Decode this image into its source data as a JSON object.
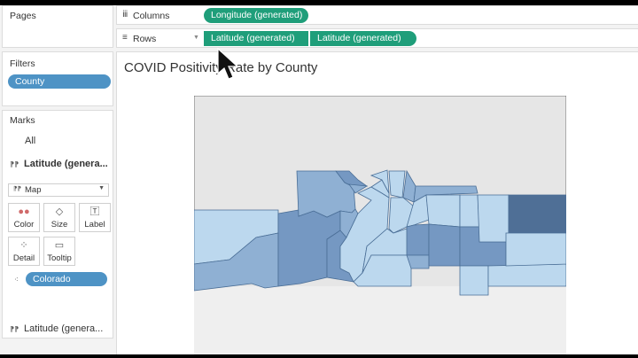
{
  "pages": {
    "title": "Pages"
  },
  "filters": {
    "title": "Filters",
    "items": [
      "County"
    ]
  },
  "marks": {
    "title": "Marks",
    "all_label": "All",
    "field_1": "Latitude (genera...",
    "type_selected": "Map",
    "buttons": {
      "color": "Color",
      "size": "Size",
      "label": "Label",
      "detail": "Detail",
      "tooltip": "Tooltip"
    },
    "detail_pill": "Colorado",
    "field_2": "Latitude (genera..."
  },
  "columns": {
    "label": "Columns",
    "pills": [
      "Longitude (generated)"
    ]
  },
  "rows": {
    "label": "Rows",
    "pills": [
      "Latitude (generated)",
      "Latitude (generated)"
    ]
  },
  "view": {
    "title": "COVID Positivity Rate by County"
  },
  "colors": {
    "pill_green": "#1f9e7a",
    "pill_blue": "#4e93c5",
    "map_light": "#bcd8ee",
    "map_dark": "#4f6f96"
  },
  "icons": [
    "columns-icon",
    "rows-icon",
    "color-icon",
    "size-icon",
    "label-icon",
    "detail-icon",
    "tooltip-icon",
    "map-icon",
    "cursor-icon"
  ]
}
